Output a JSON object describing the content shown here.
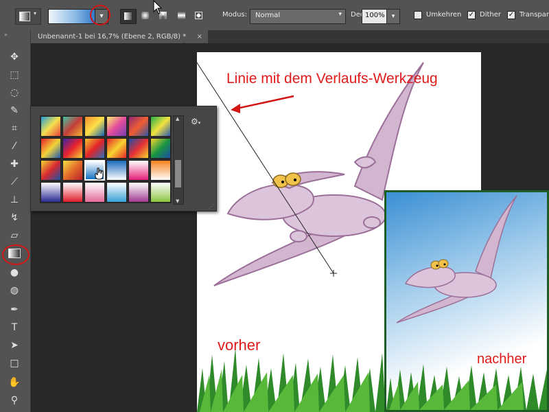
{
  "options_bar": {
    "modus_label": "Modus:",
    "modus_value": "Normal",
    "deckkraft_label": "Deckkr.:",
    "deckkraft_value": "100%",
    "umkehren_label": "Umkehren",
    "umkehren_checked": false,
    "dither_label": "Dither",
    "dither_checked": true,
    "transparenz_label": "Transparenz",
    "transparenz_checked": true
  },
  "document_tab": {
    "title": "Unbenannt-1 bei 16,7% (Ebene 2, RGB/8) *",
    "close": "×"
  },
  "annotations": {
    "line_note": "Linie mit dem Verlaufs-Werkzeug",
    "before": "vorher",
    "after": "nachher"
  },
  "colors": {
    "annotation_red": "#e01b1b",
    "after_frame_green": "#1e5c25",
    "highlight_circle": "#d41515"
  },
  "tools": [
    "move-icon",
    "marquee-icon",
    "lasso-icon",
    "quick-select-icon",
    "crop-icon",
    "eyedropper-icon",
    "healing-brush-icon",
    "brush-icon",
    "clone-stamp-icon",
    "history-brush-icon",
    "eraser-icon",
    "gradient-icon",
    "blur-icon",
    "dodge-icon",
    "pen-icon",
    "type-icon",
    "path-select-icon",
    "rectangle-icon",
    "hand-icon",
    "zoom-icon"
  ]
}
